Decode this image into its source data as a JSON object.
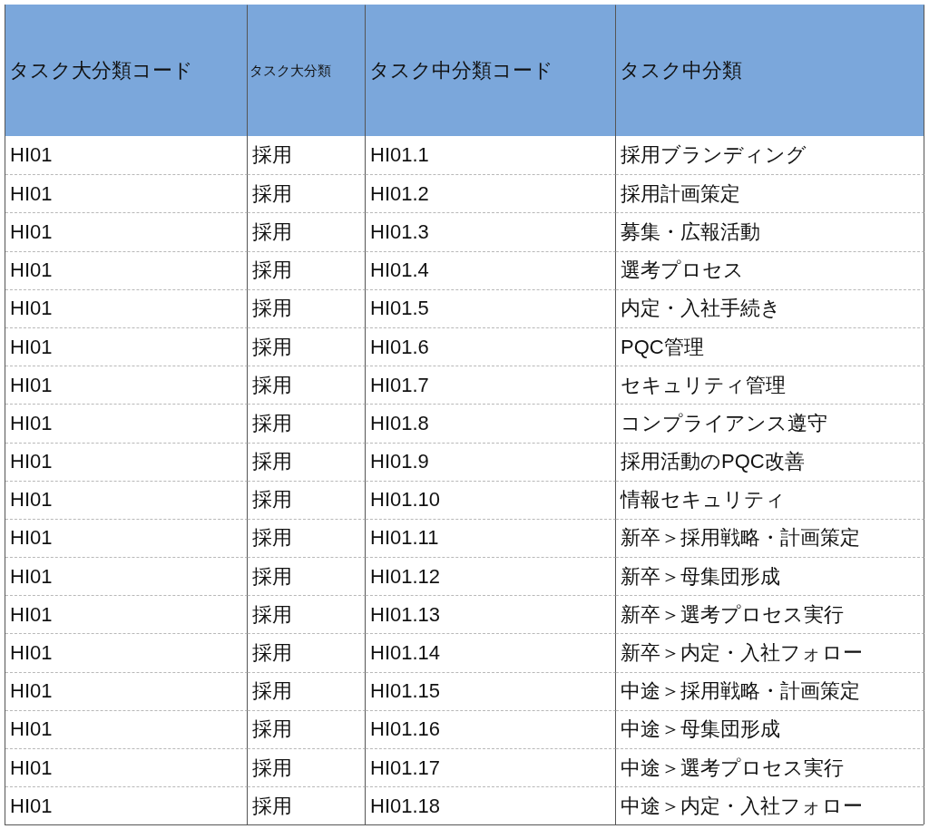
{
  "table": {
    "columns": [
      "タスク大分類コード",
      "タスク大分類",
      "タスク中分類コード",
      "タスク中分類"
    ],
    "rows": [
      [
        "HI01",
        "採用",
        "HI01.1",
        "採用ブランディング"
      ],
      [
        "HI01",
        "採用",
        "HI01.2",
        "採用計画策定"
      ],
      [
        "HI01",
        "採用",
        "HI01.3",
        "募集・広報活動"
      ],
      [
        "HI01",
        "採用",
        "HI01.4",
        "選考プロセス"
      ],
      [
        "HI01",
        "採用",
        "HI01.5",
        "内定・入社手続き"
      ],
      [
        "HI01",
        "採用",
        "HI01.6",
        "PQC管理"
      ],
      [
        "HI01",
        "採用",
        "HI01.7",
        "セキュリティ管理"
      ],
      [
        "HI01",
        "採用",
        "HI01.8",
        "コンプライアンス遵守"
      ],
      [
        "HI01",
        "採用",
        "HI01.9",
        "採用活動のPQC改善"
      ],
      [
        "HI01",
        "採用",
        "HI01.10",
        "情報セキュリティ"
      ],
      [
        "HI01",
        "採用",
        "HI01.11",
        "新卒＞採用戦略・計画策定"
      ],
      [
        "HI01",
        "採用",
        "HI01.12",
        "新卒＞母集団形成"
      ],
      [
        "HI01",
        "採用",
        "HI01.13",
        "新卒＞選考プロセス実行"
      ],
      [
        "HI01",
        "採用",
        "HI01.14",
        "新卒＞内定・入社フォロー"
      ],
      [
        "HI01",
        "採用",
        "HI01.15",
        "中途＞採用戦略・計画策定"
      ],
      [
        "HI01",
        "採用",
        "HI01.16",
        "中途＞母集団形成"
      ],
      [
        "HI01",
        "採用",
        "HI01.17",
        "中途＞選考プロセス実行"
      ],
      [
        "HI01",
        "採用",
        "HI01.18",
        "中途＞内定・入社フォロー"
      ]
    ]
  }
}
